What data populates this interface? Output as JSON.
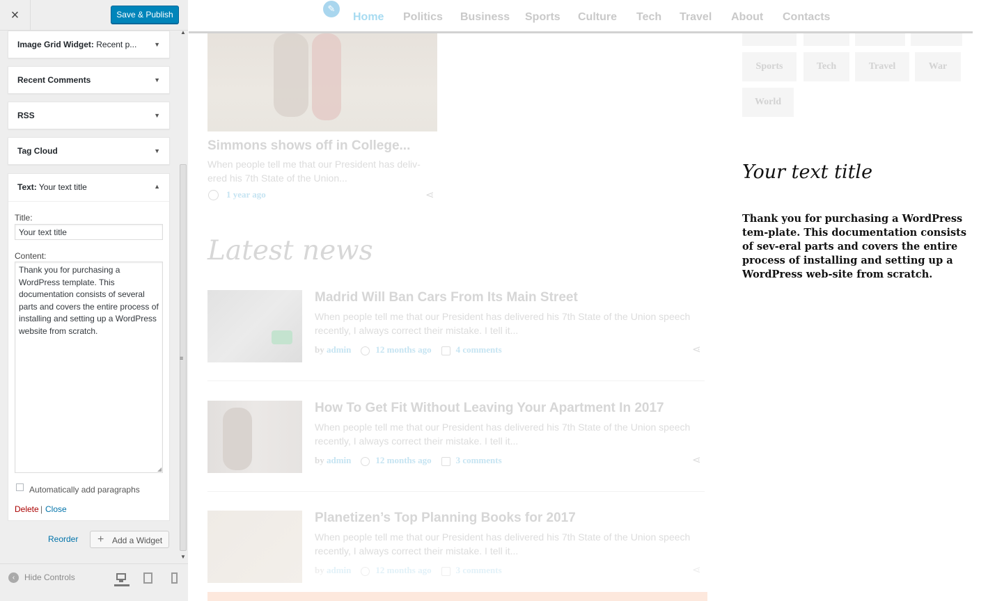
{
  "customizer": {
    "close_icon": "×",
    "save_label": "Save & Publish",
    "widgets": [
      {
        "title": "Image Grid Widget:",
        "subtitle": " Recent p..."
      },
      {
        "title": "Recent Comments",
        "subtitle": ""
      },
      {
        "title": "RSS",
        "subtitle": ""
      },
      {
        "title": "Tag Cloud",
        "subtitle": ""
      }
    ],
    "text_widget": {
      "title": "Text:",
      "subtitle": " Your text title",
      "title_label": "Title:",
      "title_value": "Your text title",
      "content_label": "Content:",
      "content_value": "Thank you for purchasing a WordPress template. This documentation consists of several parts and covers the entire process of installing and setting up a WordPress website from scratch.",
      "auto_paragraphs_label": "Automatically add paragraphs",
      "auto_paragraphs_checked": false,
      "delete_label": "Delete",
      "separator": "|",
      "close_label": "Close"
    },
    "reorder_label": "Reorder",
    "add_widget_label": "Add a Widget",
    "hide_controls_label": "Hide Controls",
    "devices": [
      "desktop-icon",
      "tablet-icon",
      "mobile-icon"
    ],
    "accent_color": "#0085ba"
  },
  "preview": {
    "nav": [
      "Home",
      "Politics",
      "Business",
      "Sports",
      "Culture",
      "Tech",
      "Travel",
      "About",
      "Contacts"
    ],
    "active_nav": "Home",
    "hero": {
      "title": "Simmons shows off in College...",
      "excerpt": "When people tell me that our President has deliv-ered his 7th State of the Union...",
      "date": "1 year ago"
    },
    "latest_heading": "Latest news",
    "posts": [
      {
        "title": "Madrid Will Ban Cars From Its Main Street",
        "excerpt": "When people tell me that our President has delivered his 7th State of the Union speech recently, I always correct their mistake.  I tell it...",
        "by": "by",
        "author": "admin",
        "date": "12 months ago",
        "comments": "4 comments"
      },
      {
        "title": "How To Get Fit Without Leaving Your Apartment In 2017",
        "excerpt": "When people tell me that our President has delivered his 7th State of the Union speech recently, I always correct their mistake.  I tell it...",
        "by": "by",
        "author": "admin",
        "date": "12 months ago",
        "comments": "3 comments"
      },
      {
        "title": "Planetizen’s Top Planning Books for 2017",
        "excerpt": "When people tell me that our President has delivered his 7th State of the Union speech recently, I always correct their mistake.  I tell it...",
        "by": "by",
        "author": "admin",
        "date": "12 months ago",
        "comments": "3 comments"
      }
    ],
    "tags": [
      "Sports",
      "Tech",
      "Travel",
      "War",
      "World"
    ],
    "text_widget_title": "Your text title",
    "text_widget_body": "Thank you for purchasing a WordPress tem-plate. This documentation consists of sev-eral parts and covers the entire process of installing and setting up a WordPress web-site from scratch."
  }
}
